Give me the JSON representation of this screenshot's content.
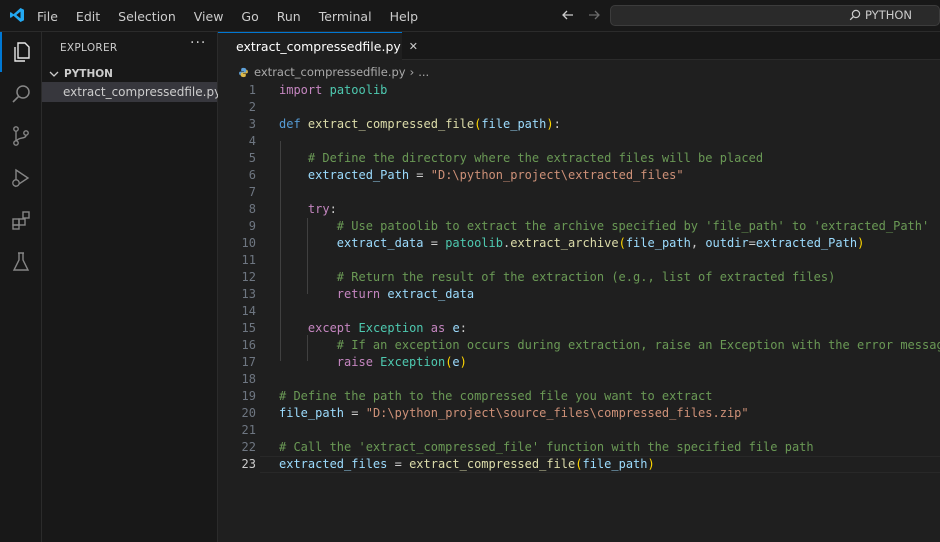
{
  "menu": [
    "File",
    "Edit",
    "Selection",
    "View",
    "Go",
    "Run",
    "Terminal",
    "Help"
  ],
  "search": {
    "label": "PYTHON"
  },
  "sidebar": {
    "title": "EXPLORER",
    "more": "···",
    "folder": "PYTHON",
    "file": "extract_compressedfile.py"
  },
  "tab": {
    "label": "extract_compressedfile.py",
    "close": "✕"
  },
  "breadcrumb": {
    "file": "extract_compressedfile.py",
    "sep": "›",
    "more": "..."
  },
  "colors": {
    "accent": "#0078d4",
    "keyword": "#569cd6",
    "control": "#c586c0",
    "function": "#dcdcaa",
    "variable": "#9cdcfe",
    "string": "#ce9178",
    "comment": "#6a9955",
    "class": "#4ec9b0"
  },
  "editor": {
    "current_line": 23,
    "lines": [
      {
        "n": "1",
        "segs": [
          [
            "kc",
            "import"
          ],
          [
            "p",
            " "
          ],
          [
            "t",
            "patoolib"
          ]
        ]
      },
      {
        "n": "2",
        "segs": []
      },
      {
        "n": "3",
        "segs": [
          [
            "k",
            "def"
          ],
          [
            "p",
            " "
          ],
          [
            "f",
            "extract_compressed_file"
          ],
          [
            "b1",
            "("
          ],
          [
            "v",
            "file_path"
          ],
          [
            "b1",
            ")"
          ],
          [
            "p",
            ":"
          ]
        ]
      },
      {
        "n": "4",
        "segs": []
      },
      {
        "n": "5",
        "segs": [
          [
            "p",
            "    "
          ],
          [
            "c",
            "# Define the directory where the extracted files will be placed"
          ]
        ]
      },
      {
        "n": "6",
        "segs": [
          [
            "p",
            "    "
          ],
          [
            "v",
            "extracted_Path"
          ],
          [
            "p",
            " = "
          ],
          [
            "s",
            "\"D:\\python_project\\extracted_files\""
          ]
        ]
      },
      {
        "n": "7",
        "segs": []
      },
      {
        "n": "8",
        "segs": [
          [
            "p",
            "    "
          ],
          [
            "kc",
            "try"
          ],
          [
            "p",
            ":"
          ]
        ]
      },
      {
        "n": "9",
        "segs": [
          [
            "p",
            "        "
          ],
          [
            "c",
            "# Use patoolib to extract the archive specified by 'file_path' to 'extracted_Path'"
          ]
        ]
      },
      {
        "n": "10",
        "segs": [
          [
            "p",
            "        "
          ],
          [
            "v",
            "extract_data"
          ],
          [
            "p",
            " = "
          ],
          [
            "t",
            "patoolib"
          ],
          [
            "p",
            "."
          ],
          [
            "f",
            "extract_archive"
          ],
          [
            "b1",
            "("
          ],
          [
            "v",
            "file_path"
          ],
          [
            "p",
            ", "
          ],
          [
            "v",
            "outdir"
          ],
          [
            "p",
            "="
          ],
          [
            "v",
            "extracted_Path"
          ],
          [
            "b1",
            ")"
          ]
        ]
      },
      {
        "n": "11",
        "segs": []
      },
      {
        "n": "12",
        "segs": [
          [
            "p",
            "        "
          ],
          [
            "c",
            "# Return the result of the extraction (e.g., list of extracted files)"
          ]
        ]
      },
      {
        "n": "13",
        "segs": [
          [
            "p",
            "        "
          ],
          [
            "kc",
            "return"
          ],
          [
            "p",
            " "
          ],
          [
            "v",
            "extract_data"
          ]
        ]
      },
      {
        "n": "14",
        "segs": []
      },
      {
        "n": "15",
        "segs": [
          [
            "p",
            "    "
          ],
          [
            "kc",
            "except"
          ],
          [
            "p",
            " "
          ],
          [
            "t",
            "Exception"
          ],
          [
            "p",
            " "
          ],
          [
            "kc",
            "as"
          ],
          [
            "p",
            " "
          ],
          [
            "v",
            "e"
          ],
          [
            "p",
            ":"
          ]
        ]
      },
      {
        "n": "16",
        "segs": [
          [
            "p",
            "        "
          ],
          [
            "c",
            "# If an exception occurs during extraction, raise an Exception with the error message"
          ]
        ]
      },
      {
        "n": "17",
        "segs": [
          [
            "p",
            "        "
          ],
          [
            "kc",
            "raise"
          ],
          [
            "p",
            " "
          ],
          [
            "t",
            "Exception"
          ],
          [
            "b1",
            "("
          ],
          [
            "v",
            "e"
          ],
          [
            "b1",
            ")"
          ]
        ]
      },
      {
        "n": "18",
        "segs": []
      },
      {
        "n": "19",
        "segs": [
          [
            "c",
            "# Define the path to the compressed file you want to extract"
          ]
        ]
      },
      {
        "n": "20",
        "segs": [
          [
            "v",
            "file_path"
          ],
          [
            "p",
            " = "
          ],
          [
            "s",
            "\"D:\\python_project\\source_files\\compressed_files.zip\""
          ]
        ]
      },
      {
        "n": "21",
        "segs": []
      },
      {
        "n": "22",
        "segs": [
          [
            "c",
            "# Call the 'extract_compressed_file' function with the specified file path"
          ]
        ]
      },
      {
        "n": "23",
        "segs": [
          [
            "v",
            "extracted_files"
          ],
          [
            "p",
            " = "
          ],
          [
            "f",
            "extract_compressed_file"
          ],
          [
            "b1",
            "("
          ],
          [
            "v",
            "file_path"
          ],
          [
            "b1",
            ")"
          ]
        ]
      }
    ]
  }
}
